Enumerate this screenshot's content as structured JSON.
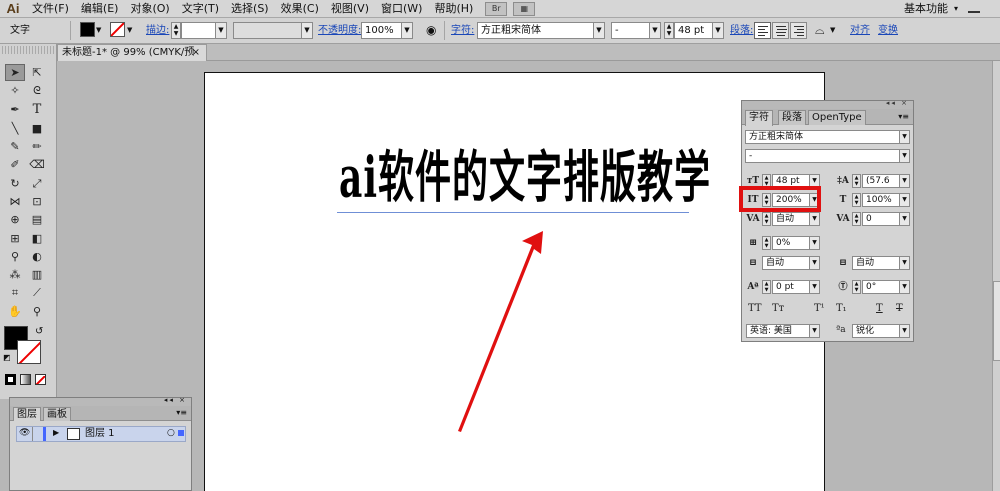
{
  "app": {
    "logo": "Ai"
  },
  "menu": [
    "文件(F)",
    "编辑(E)",
    "对象(O)",
    "文字(T)",
    "选择(S)",
    "效果(C)",
    "视图(V)",
    "窗口(W)",
    "帮助(H)"
  ],
  "menu_icons": [
    "Br",
    "▦"
  ],
  "workspace": {
    "label": "基本功能",
    "arrow": "▾"
  },
  "control_bar": {
    "tool_label": "文字",
    "stroke_label": "描边:",
    "opacity_label": "不透明度:",
    "opacity_value": "100%",
    "char_label": "字符:",
    "font_value": "方正粗宋简体",
    "style_value": "-",
    "size_value": "48 pt",
    "para_label": "段落:",
    "align_label": "对齐",
    "transform_label": "变换"
  },
  "document_tab": {
    "title": "未标题-1* @ 99% (CMYK/预览)",
    "close": "×"
  },
  "artboard": {
    "text": "ai软件的文字排版教学"
  },
  "char_panel": {
    "tabs": [
      "字符",
      "段落",
      "OpenType"
    ],
    "menu_icon": "▾≡",
    "top_buttons": "◂◂ ×",
    "font": "方正粗宋简体",
    "style": "-",
    "font_size": "48 pt",
    "leading": "(57.6",
    "vertical_scale": "200%",
    "horizontal_scale": "100%",
    "kerning": "自动",
    "tracking": "0",
    "tsume": "0%",
    "aki_left": "自动",
    "aki_right": "自动",
    "baseline_shift": "0 pt",
    "rotation": "0°",
    "language": "英语: 美国",
    "anti_alias": "锐化",
    "aa_icon": "ªa",
    "text_buttons": [
      "TT",
      "Tт",
      "T¹",
      "T₁",
      "T",
      "T"
    ]
  },
  "layers_panel": {
    "tabs": [
      "图层",
      "画板"
    ],
    "top_buttons": "◂◂ ×",
    "menu_icon": "▾≡",
    "layer_name": "图层 1"
  },
  "colors": {
    "accent": "#e01010",
    "link": "#1a47b8",
    "layer_color": "#4466ff"
  }
}
